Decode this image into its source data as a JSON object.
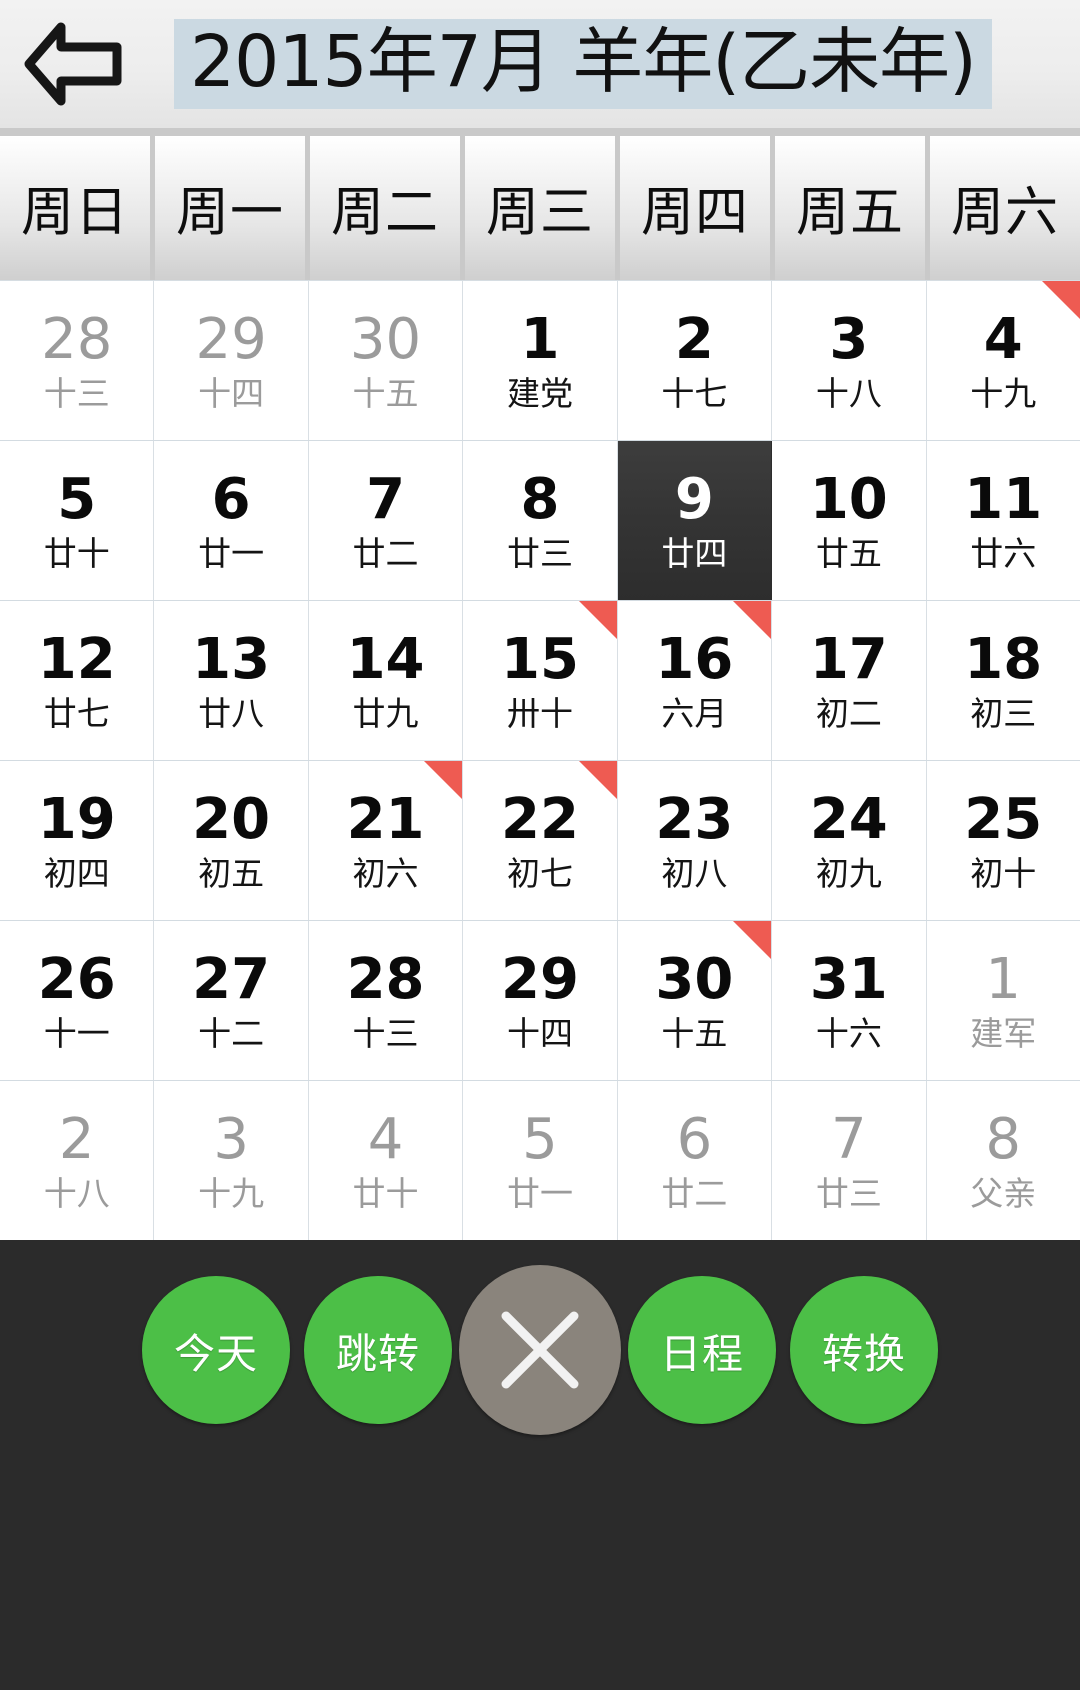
{
  "header": {
    "back_icon": "back-arrow-icon",
    "title": "2015年7月 羊年(乙未年)",
    "title_highlight_color": "#cbd9e2"
  },
  "weekdays": [
    "周日",
    "周一",
    "周二",
    "周三",
    "周四",
    "周五",
    "周六"
  ],
  "colors": {
    "accent_green": "#4cbf47",
    "close_gray": "#8a847c",
    "marker_red": "#ee5b52",
    "selected_bg": "#343434",
    "toolbar_bg": "#2b2b2b",
    "other_month_text": "#9b9b9b"
  },
  "calendar": {
    "year": 2015,
    "month": 7,
    "selected_day": 9,
    "weeks": [
      [
        {
          "num": "28",
          "lunar": "十三",
          "other": true,
          "selected": false,
          "marker": false
        },
        {
          "num": "29",
          "lunar": "十四",
          "other": true,
          "selected": false,
          "marker": false
        },
        {
          "num": "30",
          "lunar": "十五",
          "other": true,
          "selected": false,
          "marker": false
        },
        {
          "num": "1",
          "lunar": "建党",
          "other": false,
          "selected": false,
          "marker": false
        },
        {
          "num": "2",
          "lunar": "十七",
          "other": false,
          "selected": false,
          "marker": false
        },
        {
          "num": "3",
          "lunar": "十八",
          "other": false,
          "selected": false,
          "marker": false
        },
        {
          "num": "4",
          "lunar": "十九",
          "other": false,
          "selected": false,
          "marker": true
        }
      ],
      [
        {
          "num": "5",
          "lunar": "廿十",
          "other": false,
          "selected": false,
          "marker": false
        },
        {
          "num": "6",
          "lunar": "廿一",
          "other": false,
          "selected": false,
          "marker": false
        },
        {
          "num": "7",
          "lunar": "廿二",
          "other": false,
          "selected": false,
          "marker": false
        },
        {
          "num": "8",
          "lunar": "廿三",
          "other": false,
          "selected": false,
          "marker": false
        },
        {
          "num": "9",
          "lunar": "廿四",
          "other": false,
          "selected": true,
          "marker": false
        },
        {
          "num": "10",
          "lunar": "廿五",
          "other": false,
          "selected": false,
          "marker": false
        },
        {
          "num": "11",
          "lunar": "廿六",
          "other": false,
          "selected": false,
          "marker": false
        }
      ],
      [
        {
          "num": "12",
          "lunar": "廿七",
          "other": false,
          "selected": false,
          "marker": false
        },
        {
          "num": "13",
          "lunar": "廿八",
          "other": false,
          "selected": false,
          "marker": false
        },
        {
          "num": "14",
          "lunar": "廿九",
          "other": false,
          "selected": false,
          "marker": false
        },
        {
          "num": "15",
          "lunar": "卅十",
          "other": false,
          "selected": false,
          "marker": true
        },
        {
          "num": "16",
          "lunar": "六月",
          "other": false,
          "selected": false,
          "marker": true
        },
        {
          "num": "17",
          "lunar": "初二",
          "other": false,
          "selected": false,
          "marker": false
        },
        {
          "num": "18",
          "lunar": "初三",
          "other": false,
          "selected": false,
          "marker": false
        }
      ],
      [
        {
          "num": "19",
          "lunar": "初四",
          "other": false,
          "selected": false,
          "marker": false
        },
        {
          "num": "20",
          "lunar": "初五",
          "other": false,
          "selected": false,
          "marker": false
        },
        {
          "num": "21",
          "lunar": "初六",
          "other": false,
          "selected": false,
          "marker": true
        },
        {
          "num": "22",
          "lunar": "初七",
          "other": false,
          "selected": false,
          "marker": true
        },
        {
          "num": "23",
          "lunar": "初八",
          "other": false,
          "selected": false,
          "marker": false
        },
        {
          "num": "24",
          "lunar": "初九",
          "other": false,
          "selected": false,
          "marker": false
        },
        {
          "num": "25",
          "lunar": "初十",
          "other": false,
          "selected": false,
          "marker": false
        }
      ],
      [
        {
          "num": "26",
          "lunar": "十一",
          "other": false,
          "selected": false,
          "marker": false
        },
        {
          "num": "27",
          "lunar": "十二",
          "other": false,
          "selected": false,
          "marker": false
        },
        {
          "num": "28",
          "lunar": "十三",
          "other": false,
          "selected": false,
          "marker": false
        },
        {
          "num": "29",
          "lunar": "十四",
          "other": false,
          "selected": false,
          "marker": false
        },
        {
          "num": "30",
          "lunar": "十五",
          "other": false,
          "selected": false,
          "marker": true
        },
        {
          "num": "31",
          "lunar": "十六",
          "other": false,
          "selected": false,
          "marker": false
        },
        {
          "num": "1",
          "lunar": "建军",
          "other": true,
          "selected": false,
          "marker": false
        }
      ],
      [
        {
          "num": "2",
          "lunar": "十八",
          "other": true,
          "selected": false,
          "marker": false
        },
        {
          "num": "3",
          "lunar": "十九",
          "other": true,
          "selected": false,
          "marker": false
        },
        {
          "num": "4",
          "lunar": "廿十",
          "other": true,
          "selected": false,
          "marker": false
        },
        {
          "num": "5",
          "lunar": "廿一",
          "other": true,
          "selected": false,
          "marker": false
        },
        {
          "num": "6",
          "lunar": "廿二",
          "other": true,
          "selected": false,
          "marker": false
        },
        {
          "num": "7",
          "lunar": "廿三",
          "other": true,
          "selected": false,
          "marker": false
        },
        {
          "num": "8",
          "lunar": "父亲",
          "other": true,
          "selected": false,
          "marker": false
        }
      ]
    ]
  },
  "toolbar": {
    "buttons": [
      {
        "label": "今天",
        "kind": "green",
        "name": "today-button"
      },
      {
        "label": "跳转",
        "kind": "green",
        "name": "jump-button"
      },
      {
        "label": "",
        "kind": "close",
        "name": "close-button",
        "icon": "close-x-icon"
      },
      {
        "label": "日程",
        "kind": "green",
        "name": "schedule-button"
      },
      {
        "label": "转换",
        "kind": "green",
        "name": "convert-button"
      }
    ]
  }
}
